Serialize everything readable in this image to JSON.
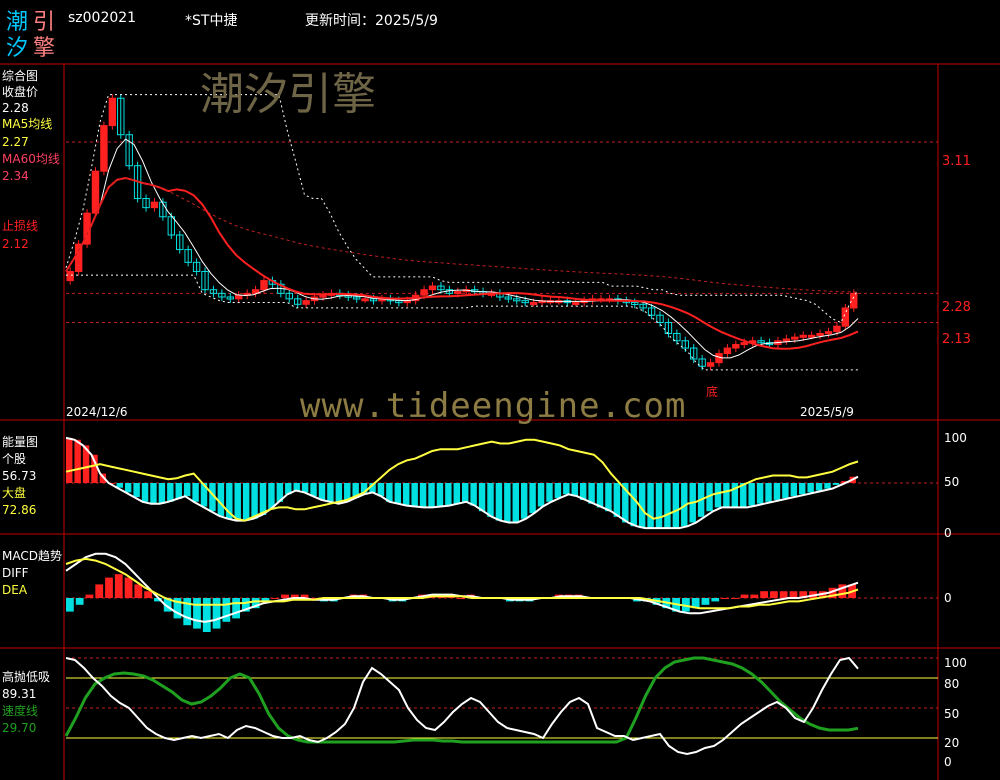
{
  "header": {
    "logo_chars": [
      "潮",
      "引",
      "汐",
      "擎"
    ],
    "code": "sz002021",
    "name": "*ST中捷",
    "update_label": "更新时间：2025/5/9"
  },
  "watermark": {
    "cn": "潮汐引擎",
    "url": "www.tideengine.com"
  },
  "colors": {
    "up": "#ff2020",
    "down": "#00e0e0",
    "ma5": "#ffffff",
    "ma60": "#ff2020",
    "yellow": "#ffff40",
    "green": "#20a020",
    "frame": "#c00000"
  },
  "panels": {
    "main": {
      "title": "综合图",
      "close_label": "收盘价",
      "close_value": "2.28",
      "ma5_label": "MA5均线",
      "ma5_value": "2.27",
      "ma60_label": "MA60均线",
      "ma60_value": "2.34",
      "stop_label": "止损线",
      "stop_value": "2.12",
      "date_start": "2024/12/6",
      "date_end": "2025/5/9",
      "bottom_marker": "底",
      "right_ticks": [
        "3.11",
        "2.28",
        "2.13"
      ]
    },
    "energy": {
      "title": "能量图",
      "stock_label": "个股",
      "stock_value": "56.73",
      "market_label": "大盘",
      "market_value": "72.86",
      "right_ticks": [
        "100",
        "50",
        "0"
      ]
    },
    "macd": {
      "title": "MACD趋势",
      "diff_label": "DIFF",
      "dea_label": "DEA",
      "right_ticks": [
        "0"
      ]
    },
    "osc": {
      "title": "高抛低吸",
      "value1": "89.31",
      "speed_label": "速度线",
      "speed_value": "29.70",
      "right_ticks": [
        "100",
        "80",
        "50",
        "20",
        "0"
      ]
    }
  },
  "chart_data": [
    {
      "type": "candlestick",
      "title": "综合图",
      "x": [
        "2024/12/6",
        "2025/5/9"
      ],
      "close": [
        2.4,
        2.55,
        2.72,
        2.95,
        3.2,
        3.35,
        3.15,
        2.98,
        2.8,
        2.75,
        2.78,
        2.7,
        2.6,
        2.52,
        2.45,
        2.4,
        2.3,
        2.28,
        2.26,
        2.25,
        2.27,
        2.28,
        2.3,
        2.35,
        2.33,
        2.28,
        2.25,
        2.22,
        2.24,
        2.26,
        2.27,
        2.28,
        2.27,
        2.26,
        2.25,
        2.25,
        2.24,
        2.25,
        2.24,
        2.23,
        2.24,
        2.27,
        2.3,
        2.32,
        2.3,
        2.28,
        2.29,
        2.3,
        2.29,
        2.28,
        2.28,
        2.26,
        2.25,
        2.24,
        2.23,
        2.23,
        2.24,
        2.24,
        2.24,
        2.23,
        2.23,
        2.24,
        2.25,
        2.25,
        2.25,
        2.24,
        2.23,
        2.22,
        2.2,
        2.16,
        2.12,
        2.06,
        2.02,
        1.98,
        1.92,
        1.88,
        1.9,
        1.95,
        1.98,
        2.0,
        2.01,
        2.02,
        2.01,
        2.0,
        2.02,
        2.03,
        2.04,
        2.05,
        2.05,
        2.06,
        2.07,
        2.1,
        2.2,
        2.28
      ],
      "ma5_value": 2.27,
      "ma60_value": 2.34,
      "stop_value": 2.12,
      "ylim": [
        1.75,
        3.45
      ]
    },
    {
      "type": "line",
      "title": "能量图",
      "series": [
        {
          "name": "个股",
          "values": [
            98,
            96,
            90,
            80,
            60,
            50,
            45,
            40,
            35,
            30,
            28,
            28,
            30,
            33,
            36,
            30,
            25,
            20,
            15,
            12,
            10,
            10,
            12,
            16,
            22,
            30,
            38,
            42,
            40,
            36,
            32,
            30,
            28,
            30,
            34,
            38,
            40,
            36,
            30,
            28,
            26,
            25,
            24,
            24,
            25,
            26,
            28,
            30,
            26,
            20,
            14,
            10,
            8,
            8,
            12,
            18,
            25,
            30,
            34,
            38,
            36,
            32,
            28,
            24,
            20,
            14,
            8,
            4,
            2,
            2,
            2,
            2,
            2,
            4,
            8,
            14,
            20,
            24,
            24,
            24,
            24,
            26,
            28,
            30,
            32,
            34,
            36,
            38,
            40,
            42,
            44,
            48,
            52,
            56.73
          ]
        },
        {
          "name": "大盘",
          "values": [
            62,
            64,
            66,
            68,
            70,
            68,
            66,
            64,
            62,
            60,
            58,
            56,
            54,
            55,
            58,
            60,
            50,
            40,
            30,
            20,
            12,
            10,
            14,
            18,
            22,
            24,
            24,
            22,
            22,
            24,
            26,
            28,
            30,
            32,
            36,
            40,
            48,
            56,
            64,
            70,
            74,
            76,
            80,
            84,
            86,
            86,
            86,
            88,
            90,
            92,
            94,
            92,
            92,
            94,
            96,
            96,
            94,
            92,
            90,
            86,
            84,
            82,
            80,
            72,
            60,
            50,
            40,
            30,
            18,
            12,
            14,
            18,
            22,
            28,
            30,
            34,
            38,
            40,
            42,
            46,
            50,
            54,
            56,
            58,
            58,
            58,
            56,
            56,
            58,
            60,
            62,
            66,
            70,
            72.86
          ]
        }
      ],
      "ylim": [
        0,
        100
      ]
    },
    {
      "type": "macd",
      "title": "MACD趋势",
      "series": [
        {
          "name": "DIFF",
          "values": [
            0.16,
            0.2,
            0.24,
            0.26,
            0.26,
            0.24,
            0.2,
            0.14,
            0.08,
            0.02,
            -0.04,
            -0.08,
            -0.11,
            -0.13,
            -0.14,
            -0.13,
            -0.11,
            -0.09,
            -0.07,
            -0.05,
            -0.03,
            -0.02,
            -0.01,
            0,
            0,
            -0.01,
            -0.01,
            -0.01,
            0,
            0.01,
            0.01,
            0,
            0,
            -0.01,
            -0.01,
            0,
            0.01,
            0.02,
            0.02,
            0.02,
            0.01,
            0.01,
            0,
            0,
            0,
            -0.01,
            -0.01,
            -0.01,
            0,
            0,
            0.01,
            0.01,
            0.01,
            0,
            0,
            0,
            0,
            0,
            -0.01,
            -0.02,
            -0.04,
            -0.06,
            -0.08,
            -0.09,
            -0.09,
            -0.08,
            -0.07,
            -0.06,
            -0.05,
            -0.04,
            -0.03,
            -0.02,
            -0.01,
            0,
            0,
            0.01,
            0.02,
            0.03,
            0.05,
            0.07,
            0.09
          ]
        },
        {
          "name": "DEA",
          "values": [
            0.2,
            0.22,
            0.23,
            0.22,
            0.2,
            0.17,
            0.14,
            0.1,
            0.06,
            0.03,
            0,
            -0.02,
            -0.03,
            -0.04,
            -0.04,
            -0.04,
            -0.04,
            -0.03,
            -0.03,
            -0.02,
            -0.02,
            -0.02,
            -0.02,
            -0.01,
            -0.01,
            -0.01,
            0,
            0,
            0,
            0,
            0,
            0,
            0,
            0,
            0,
            0,
            0,
            0.01,
            0.01,
            0.01,
            0.01,
            0,
            0,
            0,
            0,
            0,
            0,
            0,
            0,
            0,
            0,
            0,
            0,
            0,
            0,
            0,
            0,
            0,
            0,
            -0.01,
            -0.02,
            -0.03,
            -0.04,
            -0.05,
            -0.06,
            -0.06,
            -0.06,
            -0.06,
            -0.05,
            -0.05,
            -0.04,
            -0.04,
            -0.03,
            -0.02,
            -0.02,
            -0.01,
            0,
            0.01,
            0.02,
            0.03,
            0.05
          ]
        }
      ]
    },
    {
      "type": "line",
      "title": "高抛低吸",
      "series": [
        {
          "name": "",
          "values": [
            100,
            98,
            90,
            80,
            72,
            62,
            55,
            50,
            40,
            30,
            24,
            20,
            18,
            20,
            22,
            20,
            22,
            24,
            20,
            28,
            32,
            30,
            26,
            22,
            20,
            20,
            22,
            18,
            16,
            20,
            26,
            34,
            50,
            76,
            90,
            84,
            76,
            68,
            50,
            38,
            30,
            28,
            36,
            46,
            54,
            60,
            56,
            46,
            36,
            30,
            28,
            26,
            24,
            20,
            34,
            46,
            56,
            60,
            54,
            30,
            26,
            22,
            22,
            18,
            20,
            22,
            24,
            12,
            6,
            4,
            6,
            10,
            12,
            18,
            26,
            34,
            40,
            46,
            52,
            56,
            50,
            40,
            36,
            50,
            68,
            84,
            98,
            100,
            89.31
          ]
        },
        {
          "name": "速度线",
          "values": [
            22,
            40,
            60,
            74,
            80,
            84,
            85,
            84,
            82,
            78,
            72,
            66,
            58,
            54,
            56,
            62,
            70,
            80,
            84,
            80,
            64,
            44,
            30,
            22,
            18,
            16,
            16,
            16,
            16,
            16,
            16,
            16,
            16,
            16,
            16,
            17,
            18,
            18,
            18,
            17,
            17,
            16,
            16,
            16,
            16,
            16,
            16,
            16,
            16,
            16,
            16,
            16,
            16,
            16,
            16,
            16,
            16,
            16,
            20,
            40,
            62,
            80,
            90,
            96,
            98,
            100,
            100,
            98,
            96,
            94,
            90,
            84,
            76,
            66,
            56,
            48,
            40,
            34,
            30,
            28,
            28,
            28,
            29.7
          ]
        }
      ],
      "ylim": [
        0,
        100
      ]
    }
  ]
}
